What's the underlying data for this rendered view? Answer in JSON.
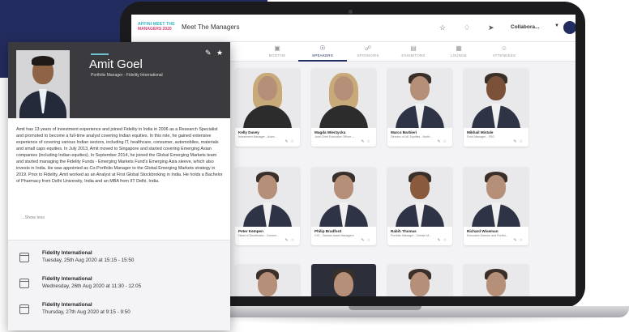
{
  "app": {
    "logo_line1": "AFFINI MEET THE",
    "logo_line2": "MANAGERS 2020",
    "title": "Meet The Managers",
    "user_name": "Collabora..."
  },
  "tabs": [
    {
      "label": "BOOTHS",
      "icon": "booths-icon"
    },
    {
      "label": "SPEAKERS",
      "icon": "speakers-icon",
      "active": true
    },
    {
      "label": "SPONSORS",
      "icon": "sponsors-icon"
    },
    {
      "label": "EXHIBITORS",
      "icon": "exhibitors-icon"
    },
    {
      "label": "LOUNGE",
      "icon": "lounge-icon"
    },
    {
      "label": "ATTENDEES",
      "icon": "attendees-icon"
    }
  ],
  "speakers": [
    {
      "name": "Kelly Davey",
      "role": "Investment Manager - Aviva..."
    },
    {
      "name": "Magda Wierzycka",
      "role": "Joint Chief Executive Officer -..."
    },
    {
      "name": "Marco Barbieri",
      "role": "Director of UK Equities - North..."
    },
    {
      "name": "Mikhail Mistale",
      "role": "Fund Manager - FSG"
    },
    {
      "name": "Peter Kempen",
      "role": "Head of Distribution - Conven..."
    },
    {
      "name": "Philip Bradford",
      "role": "CIO - Sanlam Asset Managers"
    },
    {
      "name": "Rabih Thomas",
      "role": "Portfolio Manager - Certain M..."
    },
    {
      "name": "Richard Wiseman",
      "role": "Executive Director and Portfol..."
    }
  ],
  "profile": {
    "name": "Amit Goel",
    "title": "Portfolio Manager - Fidelity International",
    "bio": "Amit has 13 years of investment experience and joined Fidelity in India in 2006 as a Research Specialist and promoted to become a full-time analyst covering Indian equities. In this role, he gained extensive experience of covering various Indian sectors, including IT, healthcare, consumer, automobiles, materials and small caps equities. In July 2013, Amit moved to Singapore and started covering Emerging Asian companies (including Indian equities). In September 2014, he joined the Global Emerging Markets team and started managing the Fidelity Funds - Emerging Markets Fund's Emerging Asia sleeve, which also invests in India. He was appointed as Co-Portfolio Manager to the Global Emerging Markets strategy in 2019. Prior to Fidelity, Amit worked as an Analyst at First Global Stockbroking in India. He holds a Bachelor of Pharmacy from Delhi University, India and an MBA from IIT Delhi, India.",
    "show_less": "...Show less",
    "sessions": [
      {
        "org": "Fidelity International",
        "when": "Tuesday, 25th Aug 2020 at 15:15 - 15:50"
      },
      {
        "org": "Fidelity International",
        "when": "Wednesday, 26th Aug 2020 at 11:30 - 12:05"
      },
      {
        "org": "Fidelity International",
        "when": "Thursday, 27th Aug 2020 at 9:15 - 9:50"
      }
    ]
  },
  "colors": {
    "navy": "#232c5e",
    "profile_header": "#3b3b3f",
    "logo_teal": "#2bb3c4",
    "logo_pink": "#d8427a"
  }
}
